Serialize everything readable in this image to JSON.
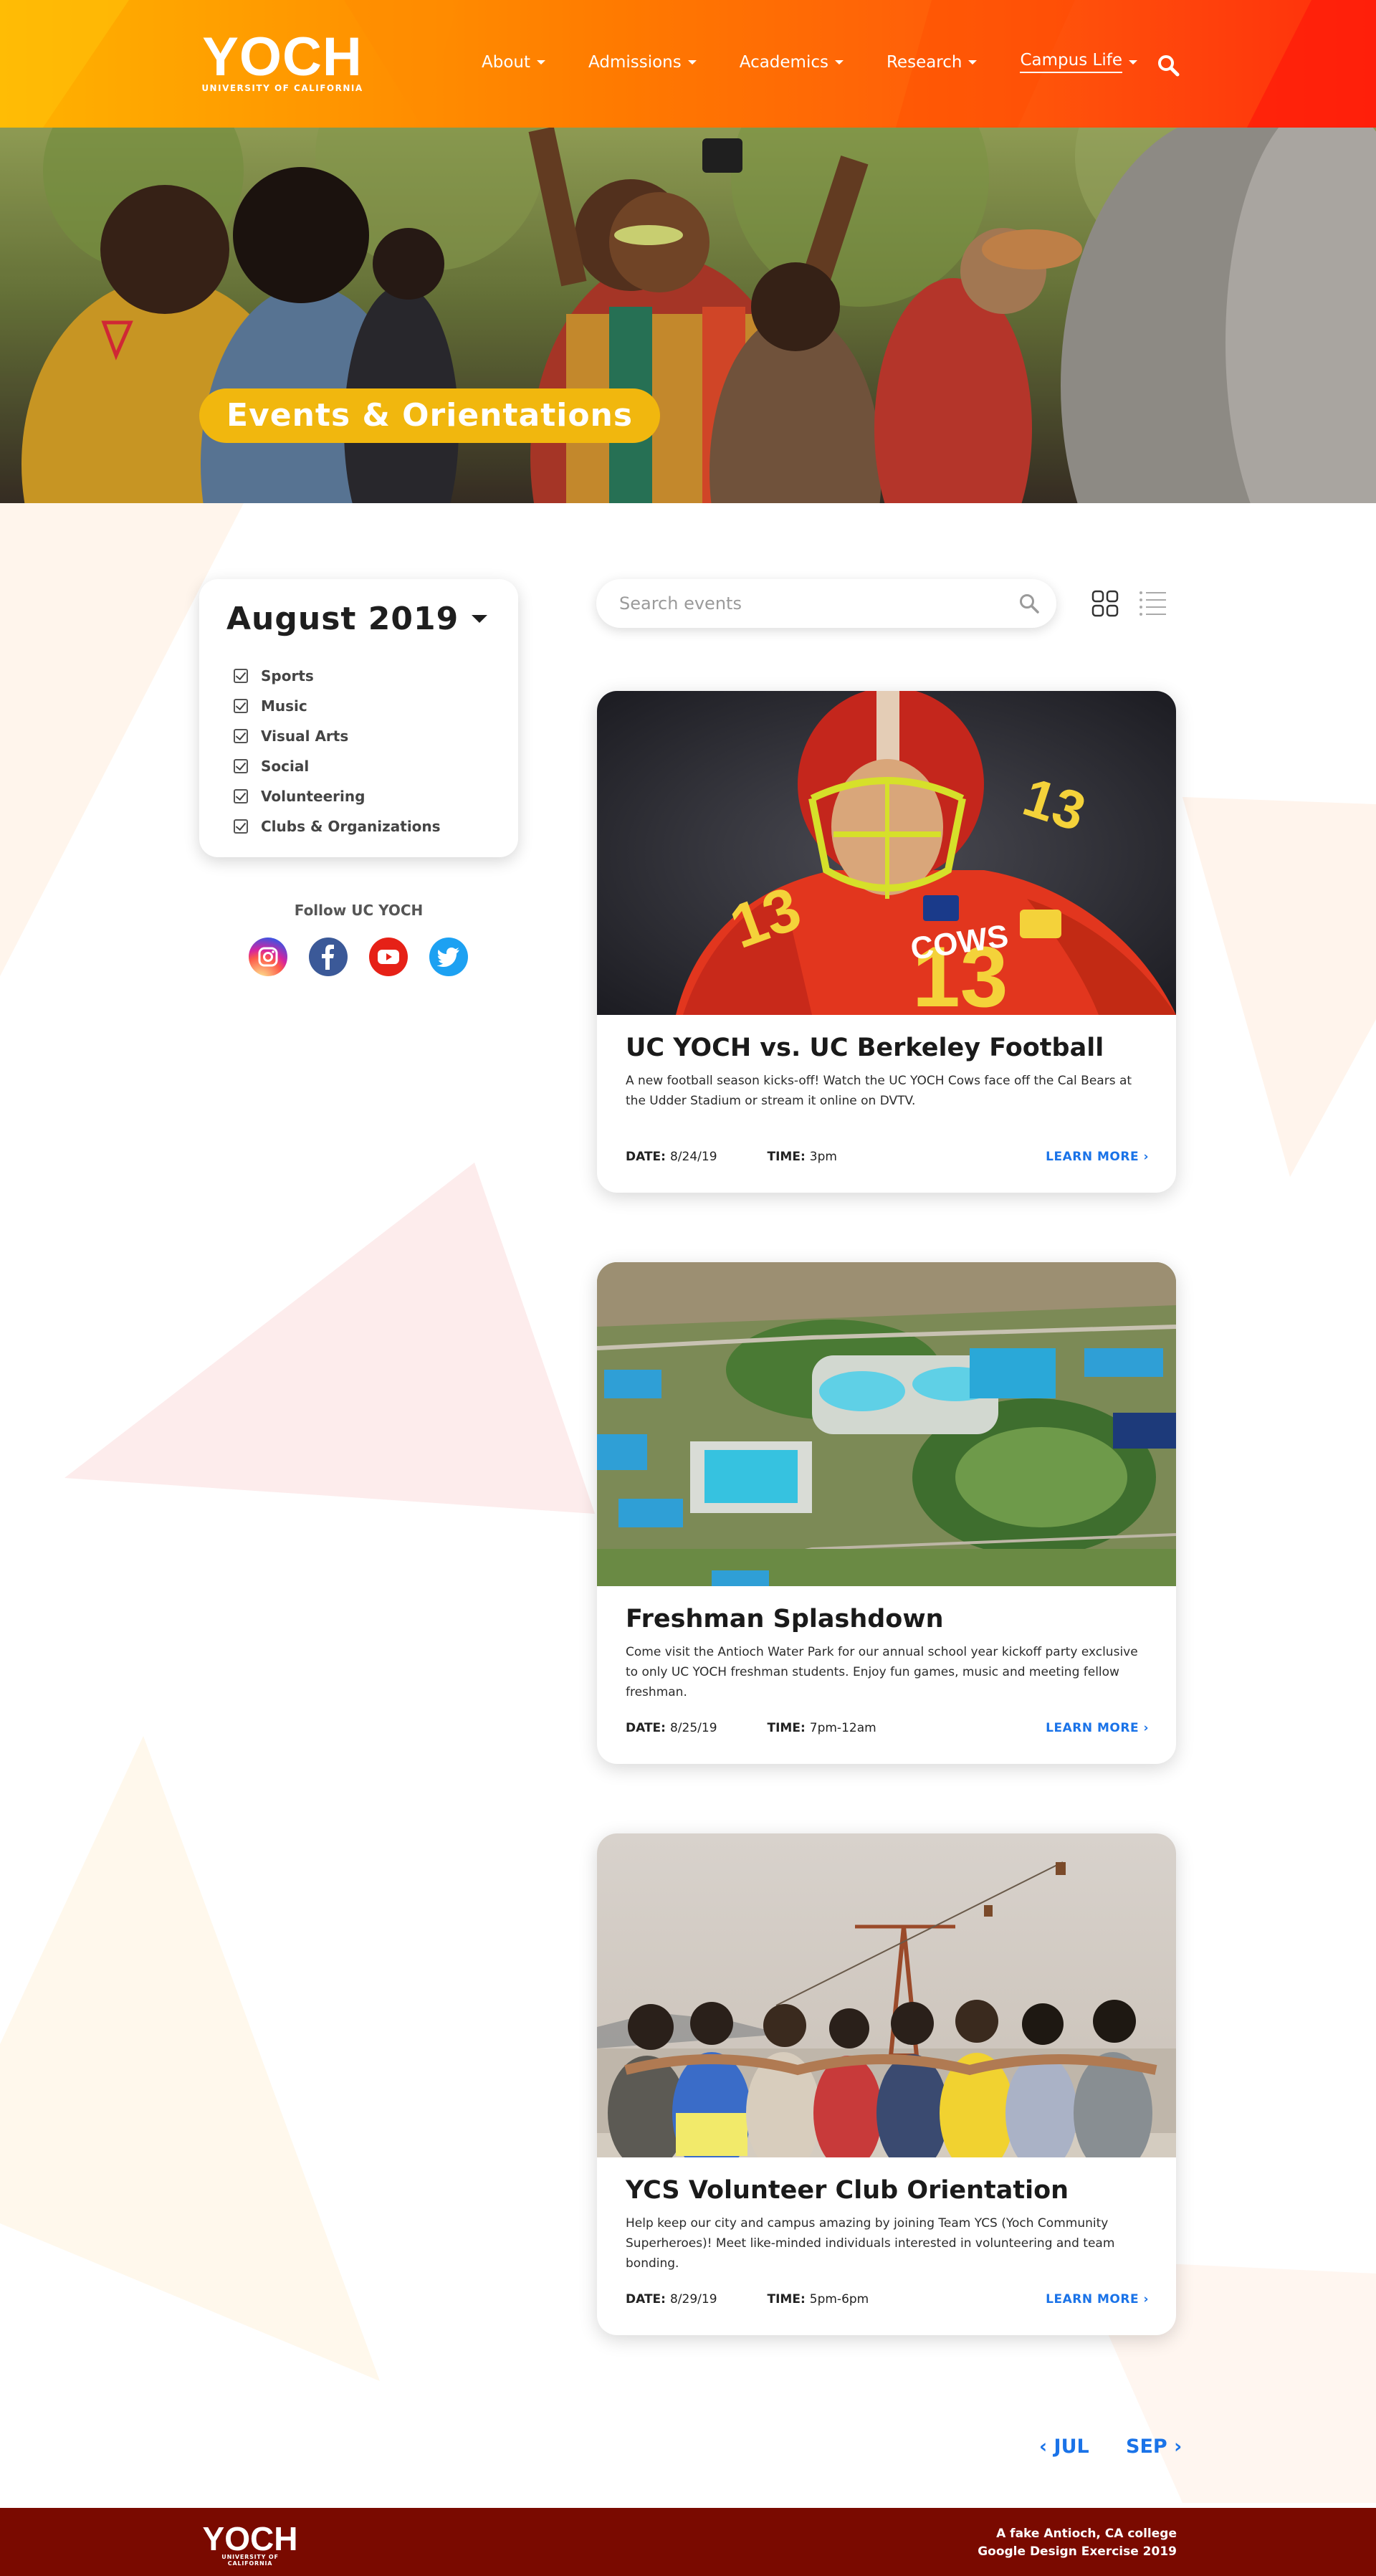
{
  "header": {
    "logo": {
      "wordmark": "YOCH",
      "subtitle": "UNIVERSITY OF CALIFORNIA"
    },
    "nav": [
      {
        "label": "About",
        "active": false
      },
      {
        "label": "Admissions",
        "active": false
      },
      {
        "label": "Academics",
        "active": false
      },
      {
        "label": "Research",
        "active": false
      },
      {
        "label": "Campus Life",
        "active": true
      }
    ],
    "search_icon": "search-icon"
  },
  "hero": {
    "title": "Events & Orientations"
  },
  "sidebar": {
    "month": "August 2019",
    "categories": [
      {
        "label": "Sports",
        "checked": true
      },
      {
        "label": "Music",
        "checked": true
      },
      {
        "label": "Visual Arts",
        "checked": true
      },
      {
        "label": "Social",
        "checked": true
      },
      {
        "label": "Volunteering",
        "checked": true
      },
      {
        "label": "Clubs & Organizations",
        "checked": true
      }
    ],
    "follow_label": "Follow UC YOCH",
    "socials": [
      {
        "name": "instagram-icon",
        "color": "#d6249f"
      },
      {
        "name": "facebook-icon",
        "color": "#3b5998"
      },
      {
        "name": "youtube-icon",
        "color": "#e62117"
      },
      {
        "name": "twitter-icon",
        "color": "#1da1f2"
      }
    ]
  },
  "search": {
    "placeholder": "Search events"
  },
  "events": [
    {
      "title": "UC YOCH vs. UC Berkeley Football",
      "description": "A new football season kicks-off! Watch the UC YOCH Cows face off the Cal Bears at the Udder Stadium or stream it online on DVTV.",
      "date_label": "DATE:",
      "date": "8/24/19",
      "time_label": "TIME:",
      "time": "3pm",
      "link": "LEARN MORE ›",
      "jersey_text": "COWS",
      "jersey_number": "13"
    },
    {
      "title": "Freshman Splashdown",
      "description": "Come visit the Antioch Water Park for our annual school year kickoff party exclusive to only UC YOCH freshman students. Enjoy fun games, music and meeting fellow freshman.",
      "date_label": "DATE:",
      "date": "8/25/19",
      "time_label": "TIME:",
      "time": "7pm-12am",
      "link": "LEARN MORE ›"
    },
    {
      "title": "YCS Volunteer Club Orientation",
      "description": "Help keep our city and campus amazing by joining Team YCS (Yoch Community Superheroes)! Meet like-minded individuals interested in volunteering and team bonding.",
      "date_label": "DATE:",
      "date": "8/29/19",
      "time_label": "TIME:",
      "time": "5pm-6pm",
      "link": "LEARN MORE ›"
    }
  ],
  "pagination": {
    "prev": "‹ JUL",
    "next": "SEP ›"
  },
  "footer": {
    "logo": {
      "wordmark": "YOCH",
      "subtitle": "UNIVERSITY OF CALIFORNIA"
    },
    "credit_line1": "A fake Antioch, CA college",
    "credit_line2": "Google Design Exercise 2019"
  },
  "colors": {
    "accent_yellow": "#f1b70e",
    "link_blue": "#1a73e8",
    "footer_red": "#7a0a00",
    "header_orange": "#ff7a00"
  }
}
